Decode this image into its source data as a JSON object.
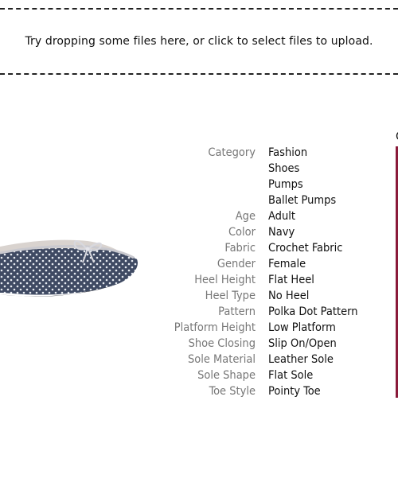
{
  "upload": {
    "prompt": "Try dropping some files here, or click to select files to upload."
  },
  "product": {
    "image_icon": "ballet-flat-shoe-image",
    "attributes": [
      {
        "label": "Category",
        "value": "Fashion"
      },
      {
        "label": "",
        "value": "Shoes"
      },
      {
        "label": "",
        "value": "Pumps"
      },
      {
        "label": "",
        "value": "Ballet Pumps"
      },
      {
        "label": "Age",
        "value": "Adult"
      },
      {
        "label": "Color",
        "value": "Navy"
      },
      {
        "label": "Fabric",
        "value": "Crochet Fabric"
      },
      {
        "label": "Gender",
        "value": "Female"
      },
      {
        "label": "Heel Height",
        "value": "Flat Heel"
      },
      {
        "label": "Heel Type",
        "value": "No Heel"
      },
      {
        "label": "Pattern",
        "value": "Polka Dot Pattern"
      },
      {
        "label": "Platform Height",
        "value": "Low Platform"
      },
      {
        "label": "Shoe Closing",
        "value": "Slip On/Open"
      },
      {
        "label": "Sole Material",
        "value": "Leather Sole"
      },
      {
        "label": "Sole Shape",
        "value": "Flat Sole"
      },
      {
        "label": "Toe Style",
        "value": "Pointy Toe"
      }
    ]
  },
  "right_panel": {
    "clipped_char": "C",
    "accent_color": "#8a1a3a"
  }
}
